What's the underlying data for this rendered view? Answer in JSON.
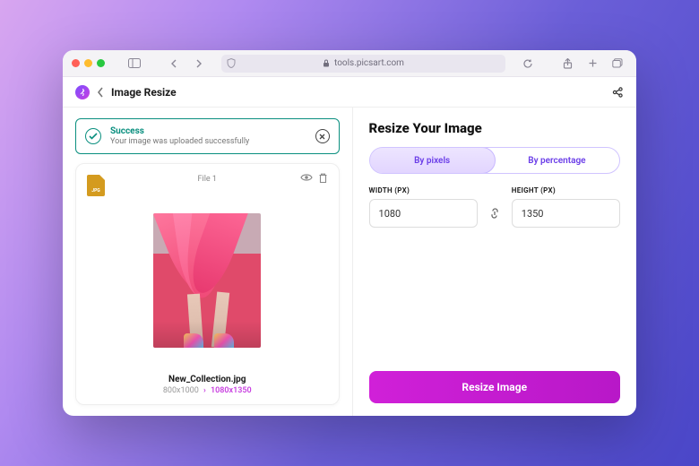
{
  "browser": {
    "url": "tools.picsart.com"
  },
  "header": {
    "title": "Image Resize"
  },
  "banner": {
    "title": "Success",
    "subtitle": "Your image was uploaded successfully"
  },
  "file": {
    "badge": "JPG",
    "label": "File 1",
    "name": "New_Collection.jpg",
    "old_dims": "800x1000",
    "new_dims": "1080x1350"
  },
  "resize": {
    "heading": "Resize Your Image",
    "tabs": {
      "pixels": "By pixels",
      "percent": "By percentage"
    },
    "width_label": "WIDTH (PX)",
    "height_label": "HEIGHT (PX)",
    "width_value": "1080",
    "height_value": "1350",
    "cta": "Resize Image"
  }
}
